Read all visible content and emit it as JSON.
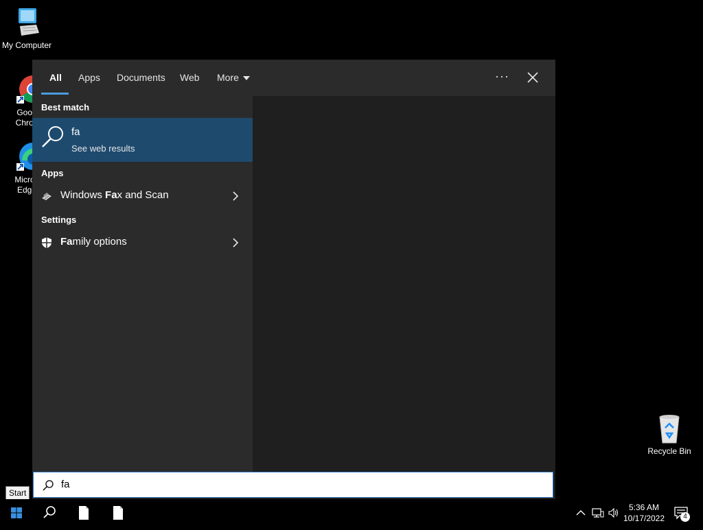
{
  "desktop": {
    "icons": {
      "my_computer": "My Computer",
      "chrome_line1": "Goog",
      "chrome_line2": "Chron",
      "edge_line1": "Micros",
      "edge_line2": "Edge",
      "recycle_bin": "Recycle Bin"
    }
  },
  "search_panel": {
    "tabs": {
      "all": "All",
      "apps": "Apps",
      "documents": "Documents",
      "web": "Web",
      "more": "More"
    },
    "options_label": "···",
    "best_match": {
      "heading": "Best match",
      "title": "fa",
      "subtitle": "See web results"
    },
    "apps": {
      "heading": "Apps",
      "item_prefix": "Windows ",
      "item_bold": "Fa",
      "item_rest": "x and Scan",
      "icon": "fax-scanner-icon"
    },
    "settings": {
      "heading": "Settings",
      "item_bold": "Fa",
      "item_rest": "mily options",
      "icon": "shield-icon"
    }
  },
  "search_box": {
    "value": "fa"
  },
  "tooltip": {
    "start": "Start"
  },
  "taskbar": {
    "clock_time": "5:36 AM",
    "clock_date": "10/17/2022",
    "notification_count": "4"
  },
  "colors": {
    "accent": "#4a9be0",
    "best_match_bg": "#1e4a6e",
    "panel_bg": "#2b2b2b"
  }
}
